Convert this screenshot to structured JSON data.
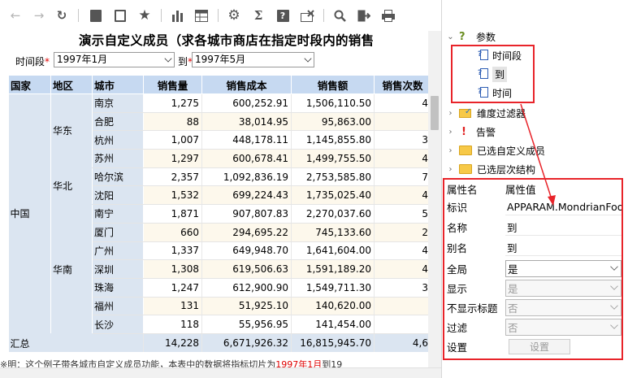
{
  "toolbar": {
    "buttons": [
      {
        "name": "back-icon",
        "glyph": "←"
      },
      {
        "name": "forward-icon",
        "glyph": "→"
      },
      {
        "name": "refresh-icon",
        "glyph": "↻"
      },
      {
        "name": "save-icon",
        "glyph": "■"
      },
      {
        "name": "save-as-icon",
        "glyph": "▣"
      },
      {
        "name": "favorite-star-icon",
        "glyph": "★"
      },
      {
        "name": "bar-chart-icon",
        "glyph": "▁▅▃"
      },
      {
        "name": "table-icon",
        "glyph": "▤"
      },
      {
        "name": "gear-icon",
        "glyph": "⚙"
      },
      {
        "name": "sigma-icon",
        "glyph": "Σ"
      },
      {
        "name": "help-icon",
        "glyph": "?"
      },
      {
        "name": "clear-filter-icon",
        "glyph": "☒"
      },
      {
        "name": "search-icon",
        "glyph": "⌕"
      },
      {
        "name": "export-icon",
        "glyph": "⇥"
      },
      {
        "name": "print-icon",
        "glyph": "⎙"
      }
    ]
  },
  "report": {
    "title": "演示自定义成员（求各城市商店在指定时段内的销售",
    "param_from_label": "时间段",
    "param_from_value": "1997年1月",
    "param_to_label": "到",
    "param_to_value": "1997年5月",
    "required_mark": "*",
    "columns": [
      "国家",
      "地区",
      "城市",
      "销售量",
      "销售成本",
      "销售额",
      "销售次数"
    ],
    "country": "中国",
    "regions": [
      {
        "name": "华东",
        "rows": [
          {
            "city": "南京",
            "qty": "1,275",
            "cost": "600,252.91",
            "sales": "1,506,110.50",
            "count": "4"
          },
          {
            "city": "合肥",
            "qty": "88",
            "cost": "38,014.95",
            "sales": "95,863.00",
            "count": ""
          },
          {
            "city": "杭州",
            "qty": "1,007",
            "cost": "448,178.11",
            "sales": "1,145,855.80",
            "count": "3"
          },
          {
            "city": "苏州",
            "qty": "1,297",
            "cost": "600,678.41",
            "sales": "1,499,755.50",
            "count": "4"
          }
        ]
      },
      {
        "name": "华北",
        "rows": [
          {
            "city": "哈尔滨",
            "qty": "2,357",
            "cost": "1,092,836.19",
            "sales": "2,753,585.80",
            "count": "7"
          },
          {
            "city": "沈阳",
            "qty": "1,532",
            "cost": "699,224.43",
            "sales": "1,735,025.40",
            "count": "4"
          }
        ]
      },
      {
        "name": "华南",
        "rows": [
          {
            "city": "南宁",
            "qty": "1,871",
            "cost": "907,807.83",
            "sales": "2,270,037.60",
            "count": "5"
          },
          {
            "city": "厦门",
            "qty": "660",
            "cost": "294,695.22",
            "sales": "745,133.60",
            "count": "2"
          },
          {
            "city": "广州",
            "qty": "1,337",
            "cost": "649,948.70",
            "sales": "1,641,604.00",
            "count": "4"
          },
          {
            "city": "深圳",
            "qty": "1,308",
            "cost": "619,506.63",
            "sales": "1,591,189.20",
            "count": "4"
          },
          {
            "city": "珠海",
            "qty": "1,247",
            "cost": "612,900.90",
            "sales": "1,549,711.30",
            "count": "3"
          },
          {
            "city": "福州",
            "qty": "131",
            "cost": "51,925.10",
            "sales": "140,620.00",
            "count": ""
          },
          {
            "city": "长沙",
            "qty": "118",
            "cost": "55,956.95",
            "sales": "141,454.00",
            "count": ""
          }
        ]
      }
    ],
    "total_label": "汇总",
    "total": {
      "qty": "14,228",
      "cost": "6,671,926.32",
      "sales": "16,815,945.70",
      "count": "4,6"
    },
    "footnote_prefix": "※明：这个例子带各城市自定义成员功能，本表中的数据将指标切片为",
    "footnote_red": "1997年1月",
    "footnote_suffix": "到19"
  },
  "tree": {
    "params_label": "参数",
    "param_items": [
      "时间段",
      "到",
      "时间"
    ],
    "dim_filter_label": "维度过滤器",
    "alert_label": "告警",
    "custom_members_label": "已选自定义成员",
    "hierarchy_label": "已选层次结构"
  },
  "props": {
    "header_key": "属性名",
    "header_value": "属性值",
    "rows": [
      {
        "key": "标识",
        "value": "APPARAM.MondrianFoo",
        "kind": "text"
      },
      {
        "key": "名称",
        "value": "到",
        "kind": "text"
      },
      {
        "key": "别名",
        "value": "到",
        "kind": "text"
      },
      {
        "key": "全局",
        "value": "是",
        "kind": "select"
      },
      {
        "key": "显示",
        "value": "是",
        "kind": "select-disabled"
      },
      {
        "key": "不显示标题",
        "value": "否",
        "kind": "select-disabled"
      },
      {
        "key": "过滤",
        "value": "否",
        "kind": "select-disabled"
      },
      {
        "key": "设置",
        "value": "设置",
        "kind": "button"
      }
    ]
  },
  "colors": {
    "header_blue": "#c6d9f1",
    "dim_blue": "#dbe5f1",
    "highlight_red": "#e8242a",
    "alt_row": "#fdf8ec"
  }
}
